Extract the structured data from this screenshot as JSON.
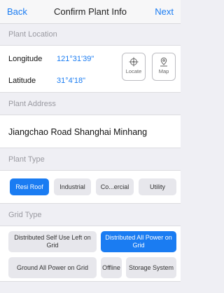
{
  "nav": {
    "back_label": "Back",
    "title": "Confirm Plant Info",
    "next_label": "Next"
  },
  "plant_location": {
    "header": "Plant Location",
    "longitude_label": "Longitude",
    "longitude_value": "121°31'39\"",
    "latitude_label": "Latitude",
    "latitude_value": "31°4'18\"",
    "locate_label": "Locate",
    "locate_icon": "crosshair-icon",
    "map_label": "Map",
    "map_icon": "map-pin-icon"
  },
  "plant_address": {
    "header": "Plant Address",
    "value": "Jiangchao Road Shanghai Minhang"
  },
  "plant_type": {
    "header": "Plant Type",
    "options": [
      "Resi Roof",
      "Industrial",
      "Co...ercial",
      "Utility"
    ],
    "selected": "Resi Roof"
  },
  "grid_type": {
    "header": "Grid Type",
    "options": [
      "Distributed Self Use Left on Grid",
      "Distributed All Power on Grid",
      "Ground All Power on Grid",
      "Offline",
      "Storage System"
    ],
    "selected": "Distributed All Power on Grid"
  },
  "colors": {
    "accent": "#1a7cf2",
    "background": "#efeff4",
    "pill": "#e7e7ec"
  }
}
